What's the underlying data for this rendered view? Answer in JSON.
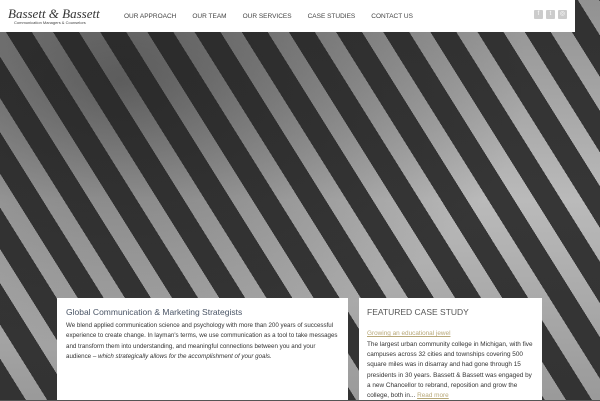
{
  "brand": {
    "name": "Bassett & Bassett",
    "tagline": "Communication Managers & Counselors"
  },
  "nav": [
    "OUR APPROACH",
    "OUR TEAM",
    "OUR SERVICES",
    "CASE STUDIES",
    "CONTACT US"
  ],
  "social": [
    {
      "icon": "facebook-icon",
      "glyph": "f"
    },
    {
      "icon": "twitter-icon",
      "glyph": "t"
    },
    {
      "icon": "instagram-icon",
      "glyph": "◎"
    }
  ],
  "intro": {
    "title": "Global Communication & Marketing Strategists",
    "body": "We blend applied communication science and psychology with more than 200 years of successful experience to create change. In layman's terms, we use communication as a tool to take messages and transform them into understanding, and meaningful connections between you and your audience – ",
    "emphasis": "which strategically allows for the accomplishment of your goals."
  },
  "case_study": {
    "heading": "FEATURED CASE STUDY",
    "link": "Growing an educational jewel",
    "body": "The largest urban community college in Michigan, with five campuses across 32 cities and townships covering 500 square miles was in disarray and had gone through 15 presidents in 30 years. Bassett & Bassett was engaged by a new Chancellor to rebrand, reposition and grow the college, both in... ",
    "read_more": "Read more"
  }
}
